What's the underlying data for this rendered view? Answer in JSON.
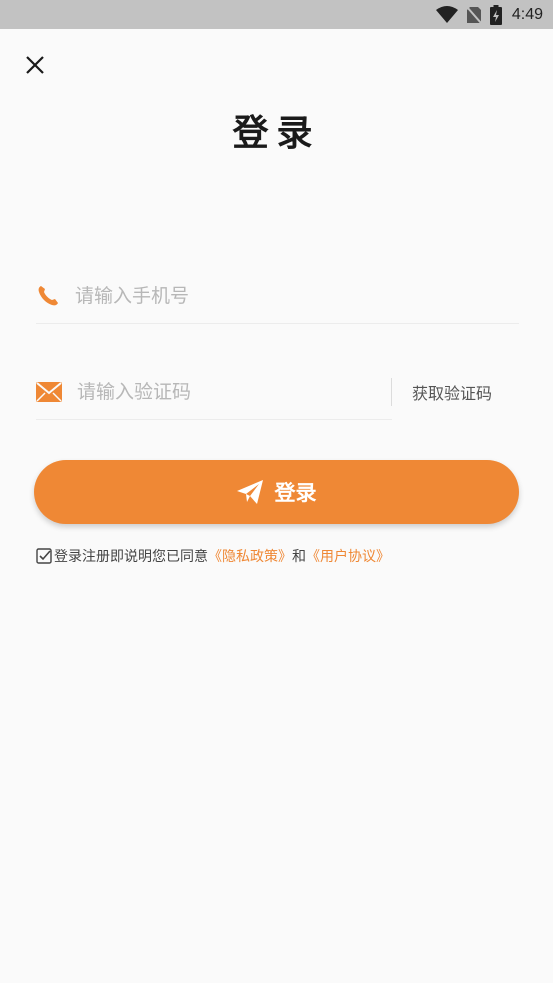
{
  "status_bar": {
    "time": "4:49",
    "icons": [
      "wifi-icon",
      "no-sim-icon",
      "battery-charging-icon"
    ]
  },
  "header": {
    "close_icon": "close-icon",
    "title": "登录"
  },
  "form": {
    "phone": {
      "icon": "phone-icon",
      "value": "",
      "placeholder": "请输入手机号"
    },
    "code": {
      "icon": "mail-icon",
      "value": "",
      "placeholder": "请输入验证码"
    },
    "get_code_label": "获取验证码",
    "login_label": "登录",
    "login_icon": "send-icon"
  },
  "agreement": {
    "checked": true,
    "text": "登录注册即说明您已同意",
    "privacy_link": "《隐私政策》",
    "and": "和",
    "user_link": "《用户协议》"
  },
  "colors": {
    "accent": "#ef8835",
    "status_bar": "#c2c2c2",
    "background": "#fafafa"
  }
}
